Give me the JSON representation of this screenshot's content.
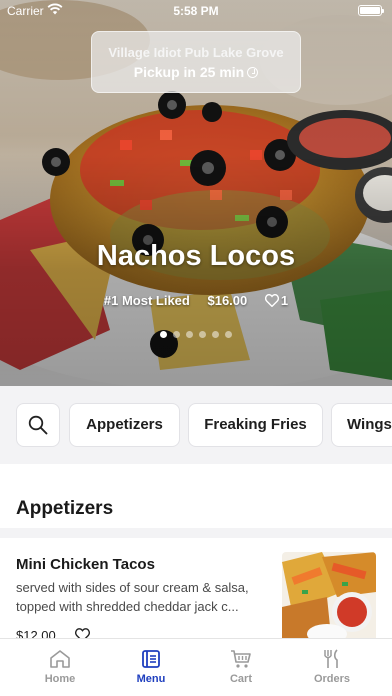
{
  "status_bar": {
    "carrier": "Carrier",
    "time": "5:58 PM"
  },
  "pickup": {
    "location": "Village Idiot Pub Lake Grove",
    "eta": "Pickup in 25 min"
  },
  "hero": {
    "title": "Nachos Locos",
    "tag": "#1 Most Liked",
    "price": "$16.00",
    "likes": "1",
    "slide_count": 6,
    "active_slide": 0
  },
  "categories": {
    "items": [
      "Appetizers",
      "Freaking Fries",
      "Wings"
    ]
  },
  "section": {
    "title": "Appetizers"
  },
  "menu_item": {
    "name": "Mini Chicken Tacos",
    "description": "served with sides of sour cream & salsa, topped with shredded cheddar jack c...",
    "price": "$12.00"
  },
  "tabs": [
    {
      "label": "Home",
      "icon": "home-icon"
    },
    {
      "label": "Menu",
      "icon": "menu-book-icon"
    },
    {
      "label": "Cart",
      "icon": "cart-icon"
    },
    {
      "label": "Orders",
      "icon": "fork-knife-icon"
    }
  ],
  "colors": {
    "accent": "#1f3fbf",
    "tab_inactive": "#9a9a9a",
    "category_bg": "#f3f3f5"
  }
}
